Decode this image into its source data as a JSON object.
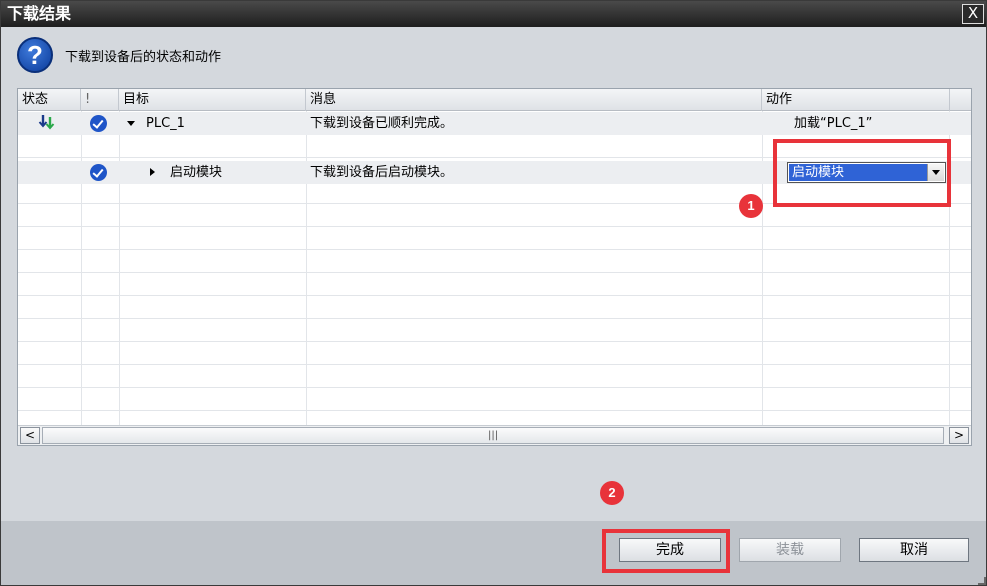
{
  "window": {
    "title": "下载结果",
    "close_symbol": "X"
  },
  "header": {
    "icon": "question-icon",
    "icon_glyph": "?",
    "text": "下载到设备后的状态和动作"
  },
  "table": {
    "columns": [
      "状态",
      "!",
      "目标",
      "消息",
      "动作"
    ],
    "rows": [
      {
        "status_icon": "download-arrow-icon",
        "check_icon": "check-circle-icon",
        "expand": "expanded",
        "target": "PLC_1",
        "message": "下载到设备已顺利完成。",
        "action": "加载“PLC_1”"
      },
      {
        "status_icon": "",
        "check_icon": "check-circle-icon",
        "expand": "collapsed",
        "target": "启动模块",
        "message": "下载到设备后启动模块。",
        "action": "启动模块"
      }
    ]
  },
  "scrollbar": {
    "left_symbol": "<",
    "right_symbol": ">",
    "grip_symbol": "|||"
  },
  "annotations": {
    "badge_1": "1",
    "badge_2": "2",
    "color": "#e8333a"
  },
  "buttons": {
    "finish": "完成",
    "load": "装载",
    "cancel": "取消"
  },
  "colors": {
    "selection": "#2f63d6",
    "check": "#1f55c8",
    "titlebar": "#2a2a2a"
  }
}
